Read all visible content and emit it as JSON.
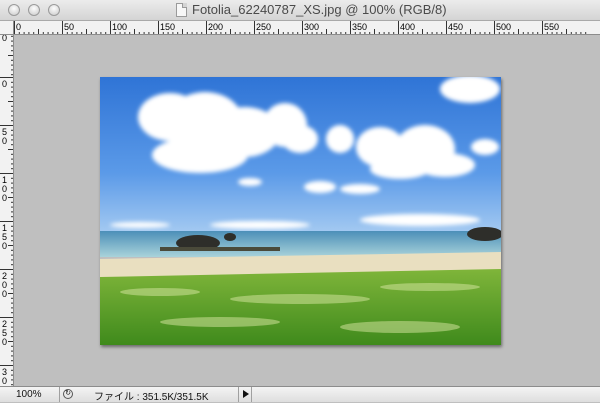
{
  "window": {
    "title": "Fotolia_62240787_XS.jpg @ 100% (RGB/8)"
  },
  "ruler_top": {
    "labels": [
      "0",
      "50",
      "100",
      "150",
      "200",
      "250",
      "300",
      "350",
      "400",
      "450",
      "500",
      "550"
    ]
  },
  "ruler_left": {
    "labels": [
      "0",
      "0",
      "50",
      "100",
      "150",
      "200",
      "250",
      "300"
    ]
  },
  "document": {
    "image_description_icon": "photo-beach-icon"
  },
  "status": {
    "zoom": "100%",
    "file_info": "ファイル : 351.5K/351.5K"
  },
  "colors": {
    "canvas_bg": "#bfbfbf",
    "sky": "#3f86e0",
    "grass": "#5c9e25"
  }
}
